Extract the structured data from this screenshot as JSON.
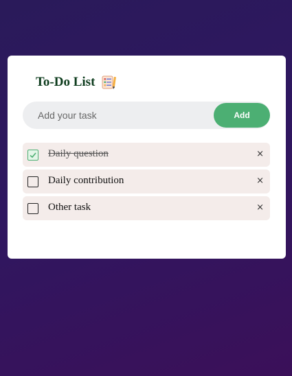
{
  "app": {
    "title": "To-Do List",
    "title_icon": "checklist-notepad-icon"
  },
  "input": {
    "placeholder": "Add your task",
    "value": ""
  },
  "add_button": {
    "label": "Add"
  },
  "tasks": [
    {
      "text": "Daily question",
      "checked": true,
      "delete_label": "×"
    },
    {
      "text": "Daily contribution",
      "checked": false,
      "delete_label": "×"
    },
    {
      "text": "Other task",
      "checked": false,
      "delete_label": "×"
    }
  ],
  "colors": {
    "accent": "#4caf73",
    "title": "#0c3b1c",
    "item_bg": "#f4ecea",
    "input_bg": "#edeef0"
  }
}
